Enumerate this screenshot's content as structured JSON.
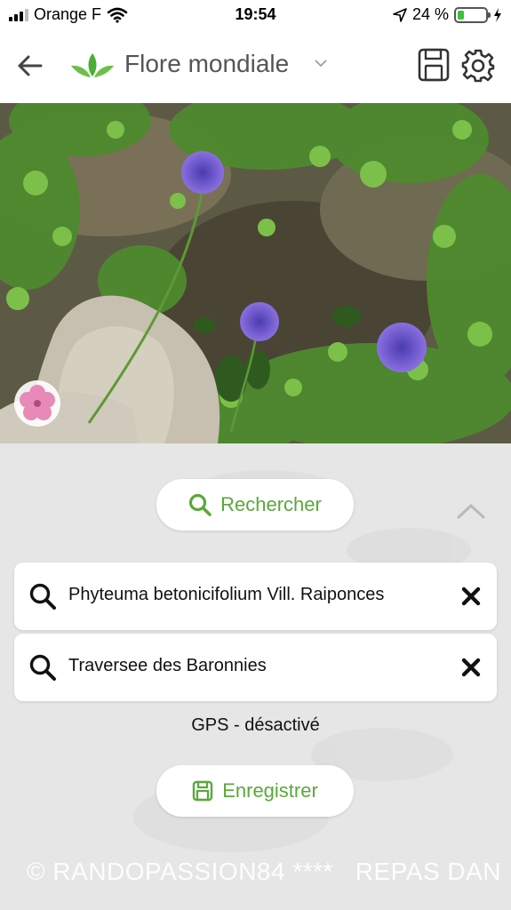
{
  "status_bar": {
    "carrier": "Orange F",
    "time": "19:54",
    "battery_percent": "24 %",
    "battery_level": 0.24
  },
  "header": {
    "title": "Flore mondiale",
    "icons": [
      "back-arrow-icon",
      "leaf-logo-icon",
      "chevron-down-icon",
      "floppy-disk-icon",
      "gear-icon"
    ]
  },
  "photo": {
    "icons": [
      "pink-flower-badge-icon"
    ]
  },
  "panel": {
    "search_button_label": "Rechercher",
    "species_field": {
      "value": "Phyteuma betonicifolium Vill. Raiponces"
    },
    "place_field": {
      "value": "Traversee des Baronnies"
    },
    "gps_status": "GPS - désactivé",
    "save_button_label": "Enregistrer",
    "watermark": "© RANDOPASSION84 ****   REPAS DAN"
  },
  "colors": {
    "accent_green": "#5aa83a",
    "panel_bg": "#e6e6e6"
  }
}
